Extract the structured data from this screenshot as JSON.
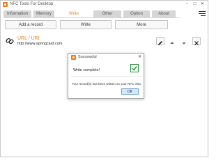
{
  "window": {
    "title": "NFC Tools For Desktop",
    "controls": [
      "−",
      "□",
      "✕"
    ]
  },
  "tabs": [
    {
      "label": "Information",
      "active": false
    },
    {
      "label": "Memory",
      "active": false
    },
    {
      "label": "Write",
      "active": true
    },
    {
      "label": "Other",
      "active": false
    },
    {
      "label": "Option",
      "active": false
    },
    {
      "label": "About",
      "active": false
    }
  ],
  "toolbar": {
    "add_label": "Add a record",
    "write_label": "Write",
    "more_label": "More"
  },
  "record": {
    "type": "URL / URI",
    "value": "http://www.springcard.com"
  },
  "dialog": {
    "title": "Successful",
    "message": "Write complete!",
    "detail": "Your record(s) has been written on your NFC chip.",
    "ok_label": "OK"
  },
  "colors": {
    "accent": "#f07c18",
    "success": "#2e8b3d",
    "tab_bg": "#d6d6d6"
  }
}
